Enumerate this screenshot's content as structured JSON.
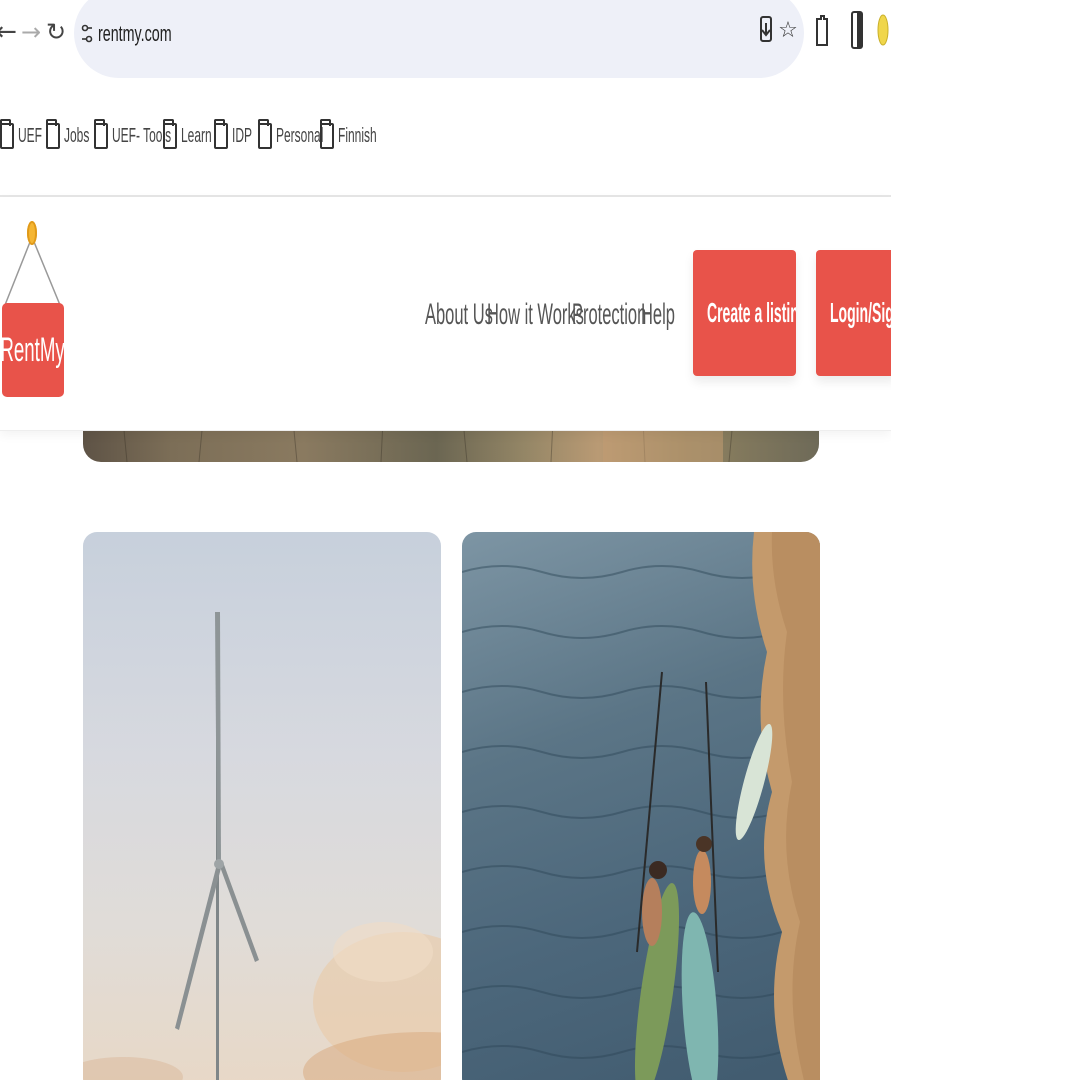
{
  "browser": {
    "url": "rentmy.com",
    "bookmarks": [
      {
        "label": "UEF"
      },
      {
        "label": "Jobs"
      },
      {
        "label": "UEF- Tools"
      },
      {
        "label": "Learn"
      },
      {
        "label": "IDP"
      },
      {
        "label": "Personal"
      },
      {
        "label": "Finnish"
      }
    ]
  },
  "site": {
    "logo_text": "RentMy",
    "nav": [
      {
        "label": "About Us"
      },
      {
        "label": "How it Works"
      },
      {
        "label": "Protection"
      },
      {
        "label": "Help"
      }
    ],
    "create_listing_label": "Create a listing",
    "login_label": "Login/Sign u"
  },
  "colors": {
    "brand": "#e8534a",
    "logo_pin": "#f5b633",
    "omnibox_bg": "#eef0f8"
  },
  "icons": [
    "back-arrow-icon",
    "forward-arrow-icon",
    "reload-icon",
    "site-info-icon",
    "install-app-icon",
    "bookmark-star-icon",
    "extensions-icon",
    "sidebar-icon",
    "profile-icon",
    "folder-icon"
  ]
}
